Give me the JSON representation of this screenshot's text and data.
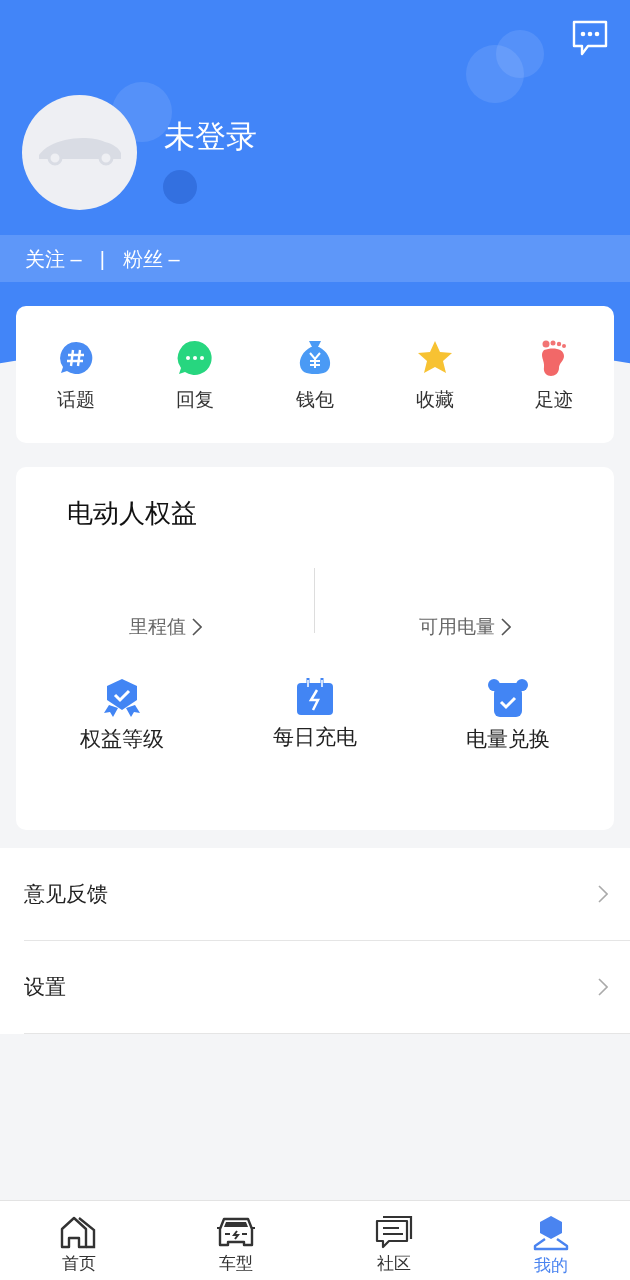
{
  "header": {
    "username": "未登录",
    "stats": [
      {
        "label": "关注",
        "value": "–"
      },
      {
        "label": "粉丝",
        "value": "–"
      }
    ],
    "separator": "|"
  },
  "quick_actions": [
    {
      "label": "话题",
      "kind": "topic"
    },
    {
      "label": "回复",
      "kind": "reply"
    },
    {
      "label": "钱包",
      "kind": "wallet"
    },
    {
      "label": "收藏",
      "kind": "favorite"
    },
    {
      "label": "足迹",
      "kind": "footprint"
    }
  ],
  "benefits": {
    "title": "电动人权益",
    "metrics": [
      {
        "label": "里程值"
      },
      {
        "label": "可用电量"
      }
    ],
    "items": [
      {
        "label": "权益等级",
        "kind": "level"
      },
      {
        "label": "每日充电",
        "kind": "charge"
      },
      {
        "label": "电量兑换",
        "kind": "exchange"
      }
    ]
  },
  "menu": [
    {
      "label": "意见反馈"
    },
    {
      "label": "设置"
    }
  ],
  "tabs": [
    {
      "label": "首页",
      "kind": "home",
      "selected": false
    },
    {
      "label": "车型",
      "kind": "car",
      "selected": false
    },
    {
      "label": "社区",
      "kind": "community",
      "selected": false
    },
    {
      "label": "我的",
      "kind": "me",
      "selected": true
    }
  ]
}
